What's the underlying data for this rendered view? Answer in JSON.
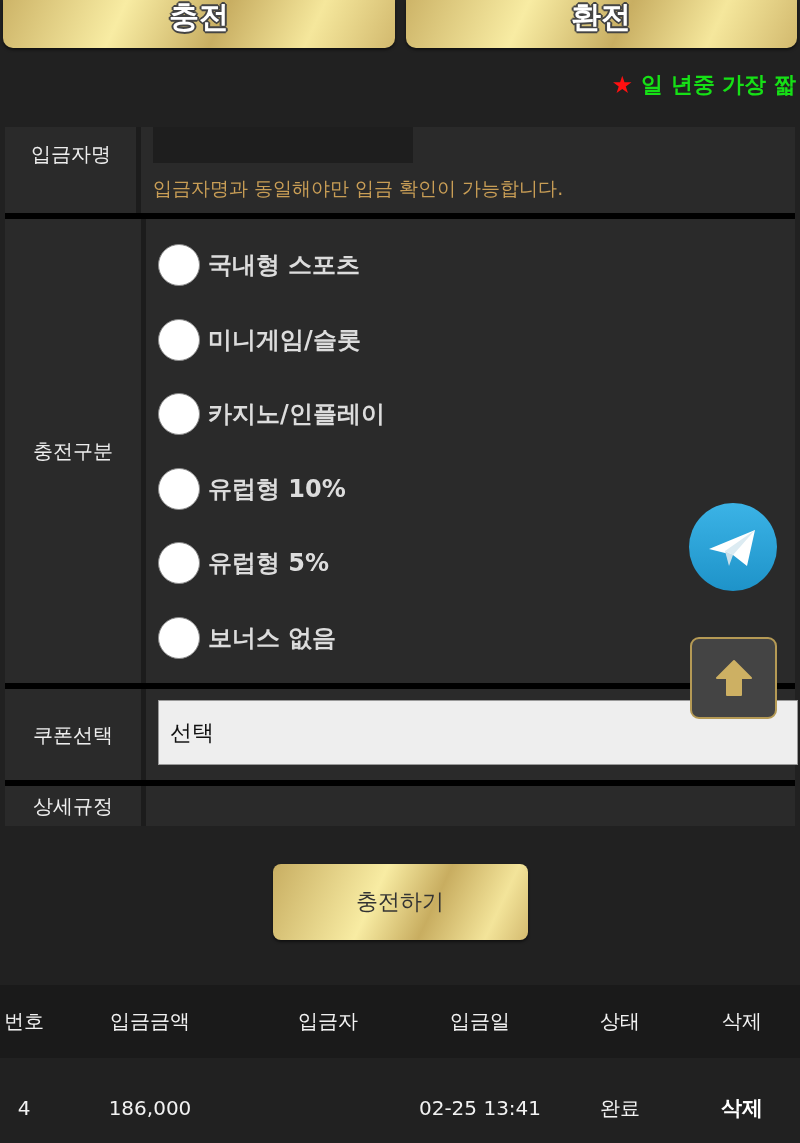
{
  "top_buttons": [
    {
      "label": "충전"
    },
    {
      "label": "환전"
    }
  ],
  "notice": {
    "star": "★",
    "text": "일 년중 가장 짧"
  },
  "form": {
    "depositor": {
      "label": "입금자명",
      "hint": "입금자명과 동일해야만 입금 확인이 가능합니다."
    },
    "charge_type": {
      "label": "충전구분",
      "options": [
        {
          "label": "국내형 스포츠",
          "selected": false
        },
        {
          "label": "미니게임/슬롯",
          "selected": false
        },
        {
          "label": "카지노/인플레이",
          "selected": false
        },
        {
          "label": "유럽형 10%",
          "selected": false
        },
        {
          "label": "유럽형 5%",
          "selected": false
        },
        {
          "label": "보너스 없음",
          "selected": false
        }
      ]
    },
    "coupon": {
      "label": "쿠폰선택",
      "value": "선택"
    },
    "rules": {
      "label": "상세규정"
    }
  },
  "submit_button": "충전하기",
  "history": {
    "columns": [
      "번호",
      "입금금액",
      "입금자",
      "입금일",
      "상태",
      "삭제"
    ],
    "rows": [
      {
        "no": "4",
        "amount": "186,000",
        "date": "02-25 13:41",
        "status": "완료",
        "action": "삭제"
      }
    ]
  }
}
